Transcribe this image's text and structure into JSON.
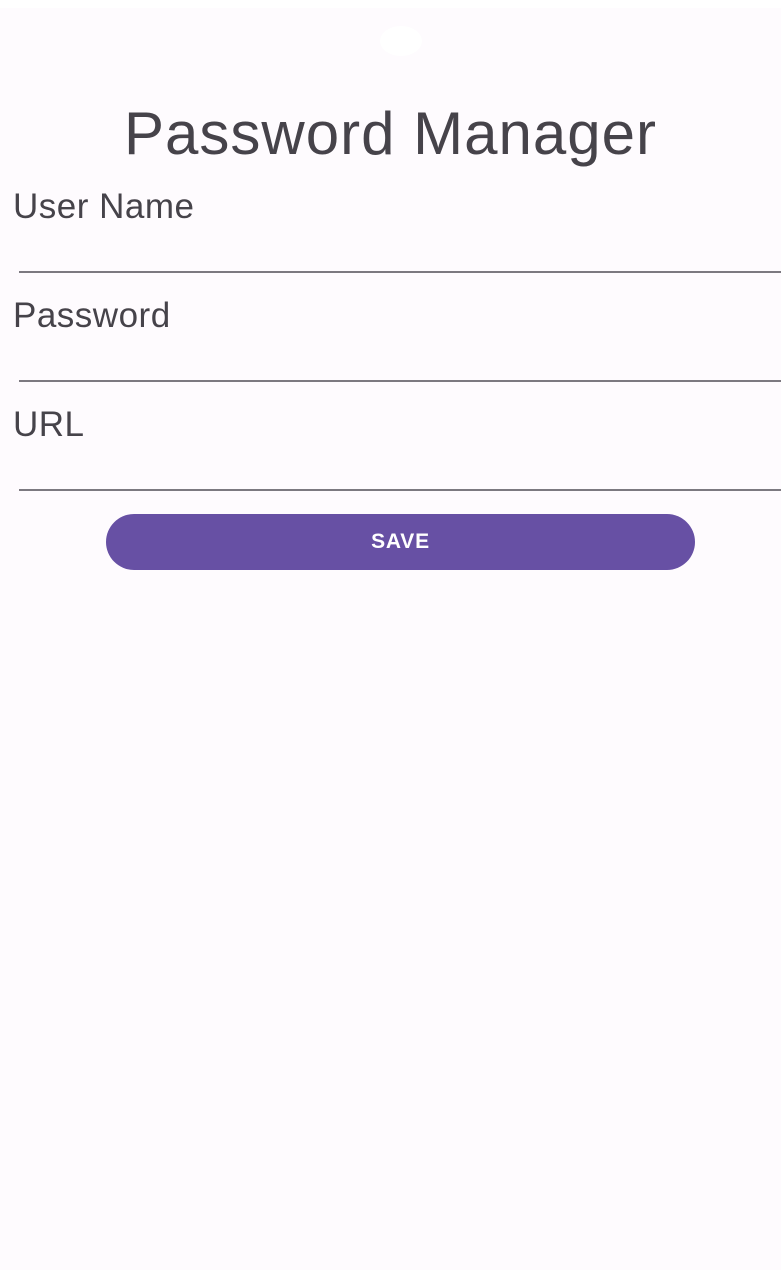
{
  "header": {
    "title": "Password Manager"
  },
  "form": {
    "fields": [
      {
        "label": "User Name",
        "value": "",
        "placeholder": ""
      },
      {
        "label": "Password",
        "value": "",
        "placeholder": ""
      },
      {
        "label": "URL",
        "value": "",
        "placeholder": ""
      }
    ],
    "save_label": "SAVE"
  },
  "colors": {
    "background": "#fefbfe",
    "text": "#46434a",
    "accent": "#6750a4",
    "underline": "#7c7980"
  }
}
